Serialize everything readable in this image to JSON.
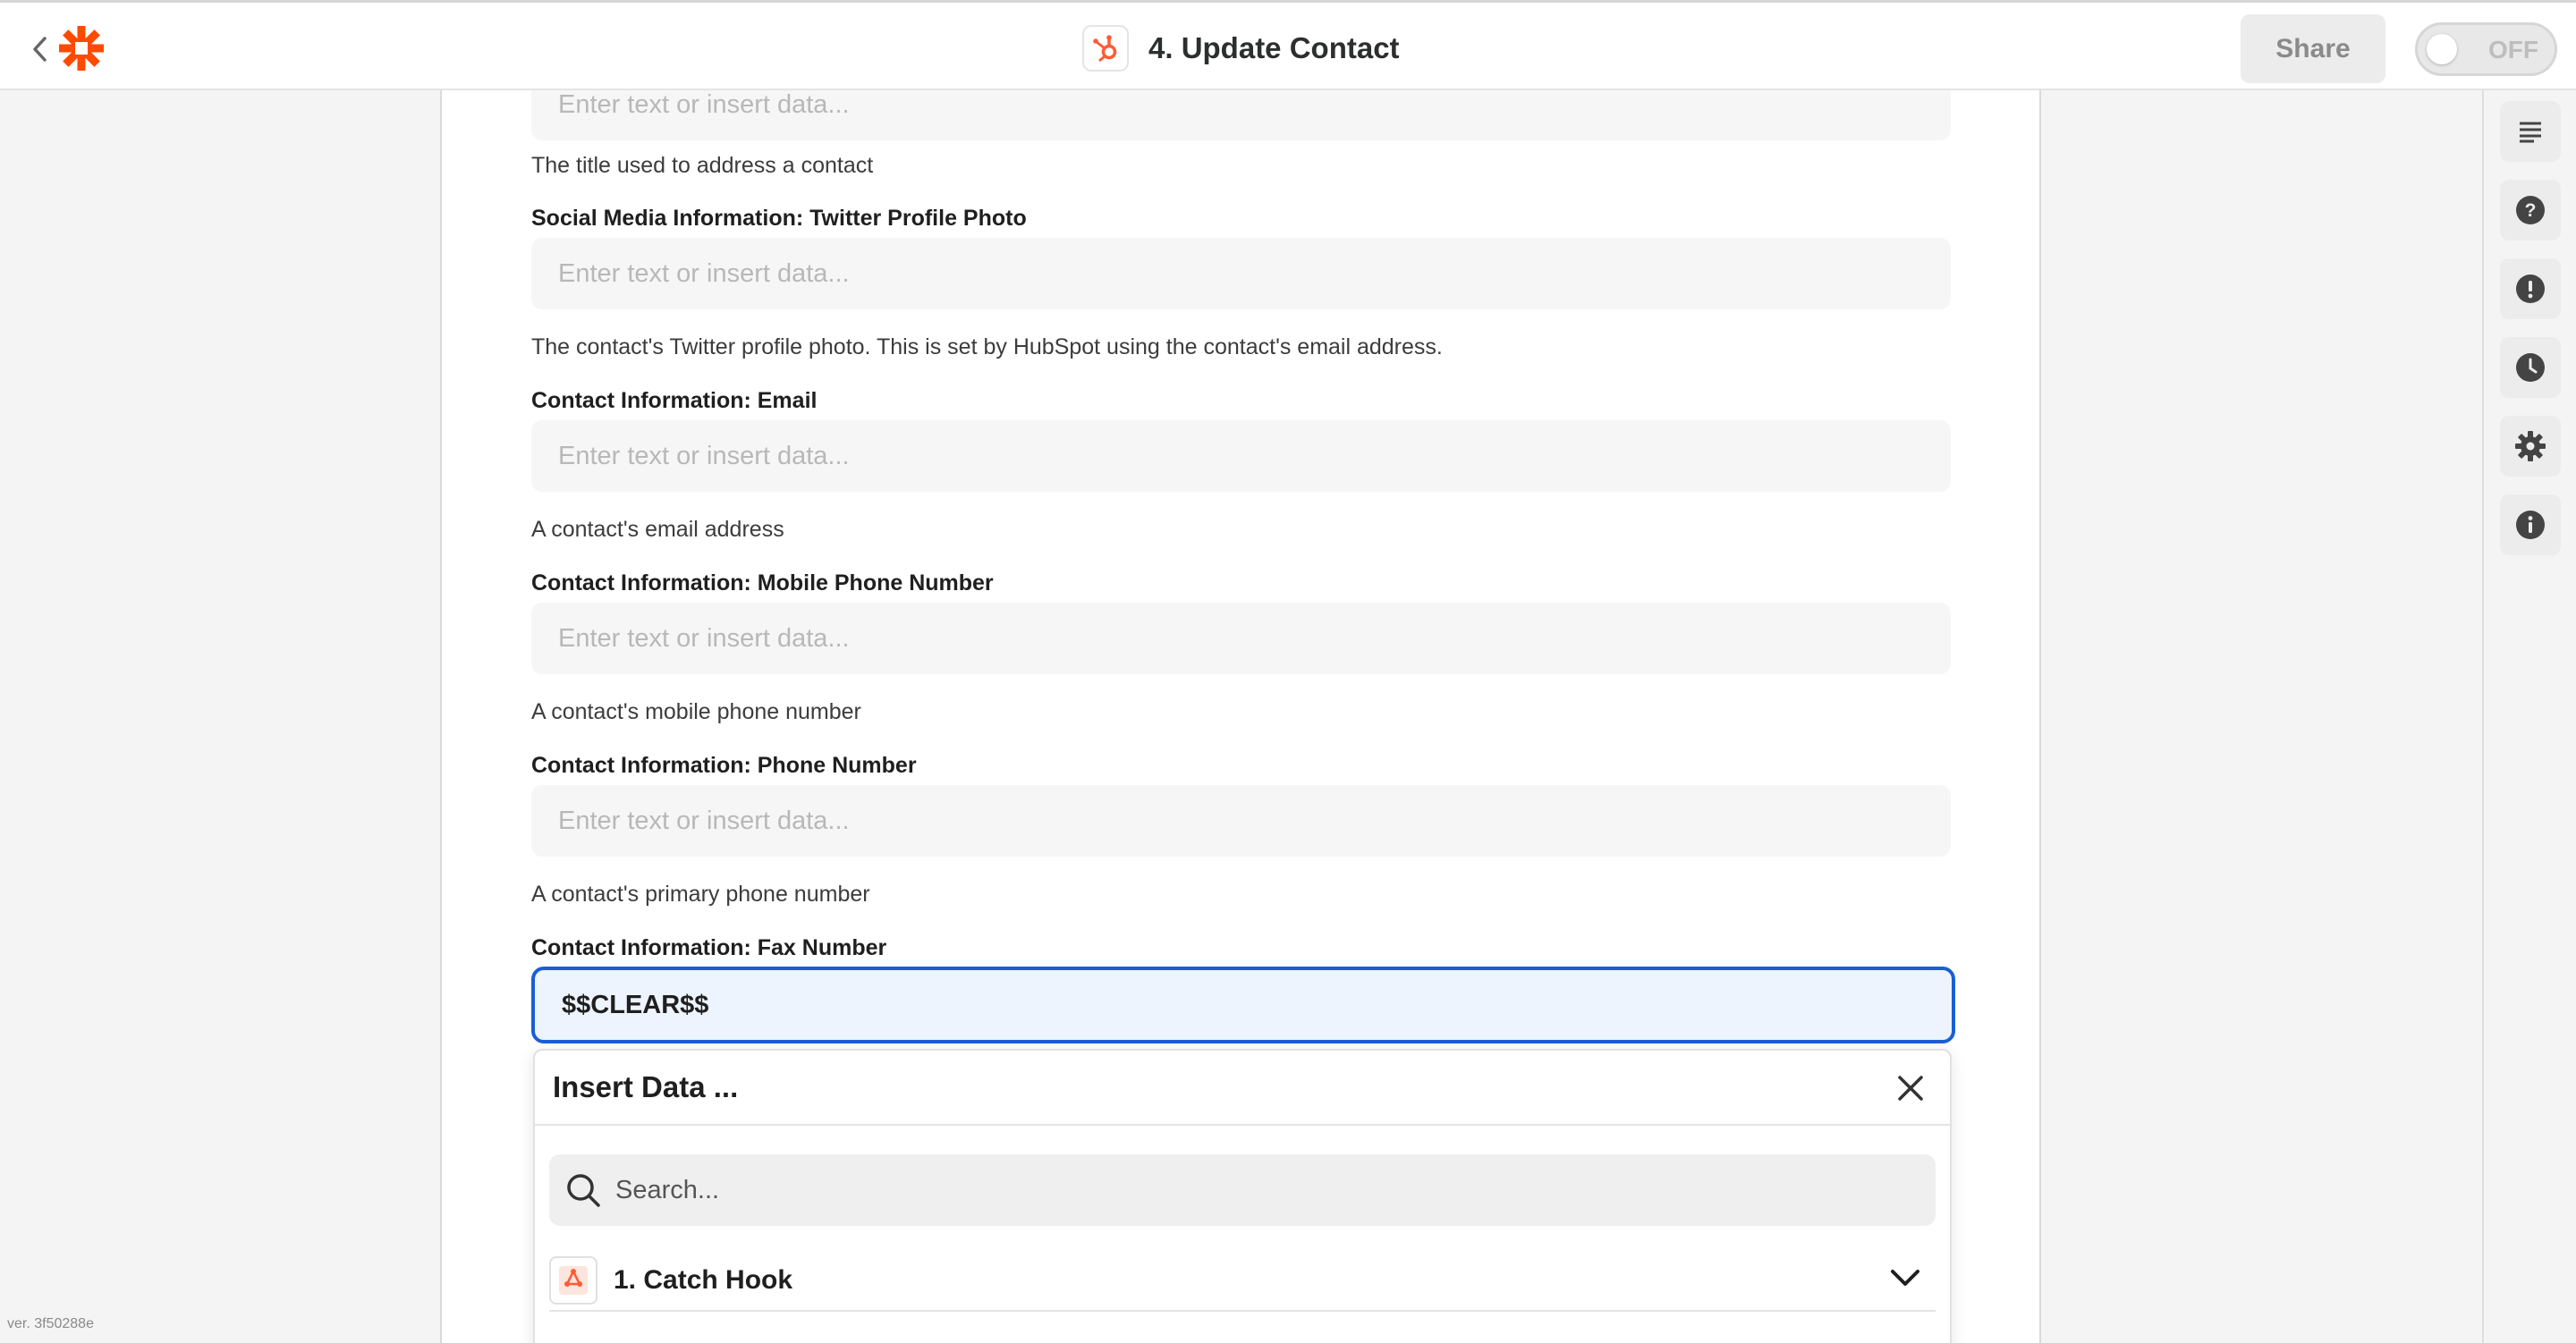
{
  "header": {
    "step_title": "4. Update Contact",
    "share_label": "Share",
    "toggle_label": "OFF",
    "brand_color": "#ff4a00",
    "app_icon": "hubspot-icon"
  },
  "form": {
    "top_partial_placeholder": "Enter text or insert data...",
    "top_partial_help": "The title used to address a contact",
    "fields": [
      {
        "label": "Social Media Information: Twitter Profile Photo",
        "placeholder": "Enter text or insert data...",
        "help": "The contact's Twitter profile photo. This is set by HubSpot using the contact's email address."
      },
      {
        "label": "Contact Information: Email",
        "placeholder": "Enter text or insert data...",
        "help": "A contact's email address"
      },
      {
        "label": "Contact Information: Mobile Phone Number",
        "placeholder": "Enter text or insert data...",
        "help": "A contact's mobile phone number"
      },
      {
        "label": "Contact Information: Phone Number",
        "placeholder": "Enter text or insert data...",
        "help": "A contact's primary phone number"
      }
    ],
    "active_field": {
      "label": "Contact Information: Fax Number",
      "value": "$$CLEAR$$",
      "focus_color": "#1a5fd6"
    }
  },
  "insert_data": {
    "title": "Insert Data ...",
    "search_placeholder": "Search...",
    "items": [
      {
        "label": "1. Catch Hook",
        "icon": "webhook-icon"
      }
    ]
  },
  "rail": {
    "buttons": [
      "outline-icon",
      "help-icon",
      "alert-icon",
      "history-icon",
      "settings-icon",
      "info-icon"
    ]
  },
  "footer": {
    "version": "ver. 3f50288e"
  }
}
